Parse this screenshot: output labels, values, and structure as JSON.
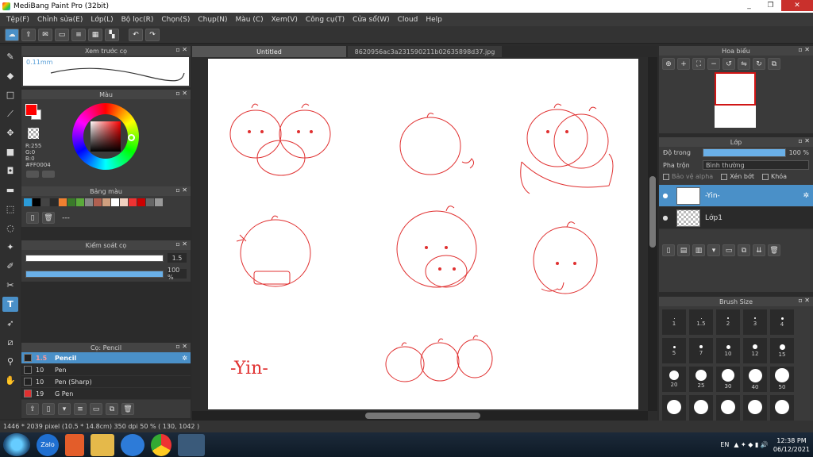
{
  "window": {
    "title": "MediBang Paint Pro (32bit)",
    "min": "_",
    "restore": "❐",
    "close": "✕"
  },
  "menu": [
    "Tệp(F)",
    "Chỉnh sửa(E)",
    "Lớp(L)",
    "Bộ lọc(R)",
    "Chọn(S)",
    "Chụp(N)",
    "Màu (C)",
    "Xem(V)",
    "Công cụ(T)",
    "Cửa sổ(W)",
    "Cloud",
    "Help"
  ],
  "toolbar": {
    "undo": "↶",
    "redo": "↷"
  },
  "panels": {
    "brush_preview": {
      "title": "Xem trước cọ",
      "size_label": "0.11mm"
    },
    "color": {
      "title": "Màu",
      "values": [
        "R:255",
        "G:0",
        "B:0",
        "#FF0004"
      ],
      "fg": "#ff0000"
    },
    "palette": {
      "title": "Bảng màu",
      "colors": [
        "#2b9bd8",
        "#000000",
        "#444444",
        "#2a2a2a",
        "#f08030",
        "#3a7a2a",
        "#5aaa3a",
        "#888888",
        "#b06050",
        "#d0a080",
        "#ffffff",
        "#f0d0c0",
        "#ee3333",
        "#cc0000",
        "#666666",
        "#999999"
      ],
      "more": "---"
    },
    "brush_control": {
      "title": "Kiểm soát cọ",
      "size": "1.5",
      "opacity": "100 %",
      "opacity_value": 100
    },
    "brushes": {
      "title": "Cọ: Pencil",
      "items": [
        {
          "size": "1.5",
          "name": "Pencil",
          "color": "#222222",
          "active": true
        },
        {
          "size": "10",
          "name": "Pen",
          "color": "#222222",
          "active": false
        },
        {
          "size": "10",
          "name": "Pen (Sharp)",
          "color": "#222222",
          "active": false
        },
        {
          "size": "19",
          "name": "G Pen",
          "color": "#e03030",
          "active": false
        }
      ]
    }
  },
  "tabs": [
    {
      "label": "Untitled",
      "active": true
    },
    {
      "label": "8620956ac3a231590211b02635898d37.jpg",
      "active": false
    }
  ],
  "canvas": {
    "signature": "-Yin-"
  },
  "navigator": {
    "title": "Hoa biểu"
  },
  "layer_panel": {
    "title": "Lớp",
    "opacity_label": "Độ trong",
    "opacity_value": "100 %",
    "blend_label": "Pha trộn",
    "blend_mode": "Bình thường",
    "protect_alpha": "Bảo vệ alpha",
    "clip": "Xén bớt",
    "lock": "Khóa",
    "layers": [
      {
        "name": "-Yin-",
        "active": true
      },
      {
        "name": "Lớp1",
        "active": false
      }
    ]
  },
  "brush_size": {
    "title": "Brush Size",
    "sizes": [
      "1",
      "1.5",
      "2",
      "3",
      "4",
      "5",
      "7",
      "10",
      "12",
      "15",
      "20",
      "25",
      "30",
      "40",
      "50",
      "",
      "",
      "",
      "",
      ""
    ]
  },
  "status": {
    "text": "1446 * 2039 pixel  (10.5 * 14.8cm)  350 dpi  50 %  ( 130, 1042 )"
  },
  "taskbar": {
    "apps": [
      "Zalo",
      "",
      "",
      "",
      "",
      ""
    ],
    "lang": "EN",
    "time": "12:38 PM",
    "date": "06/12/2021"
  }
}
